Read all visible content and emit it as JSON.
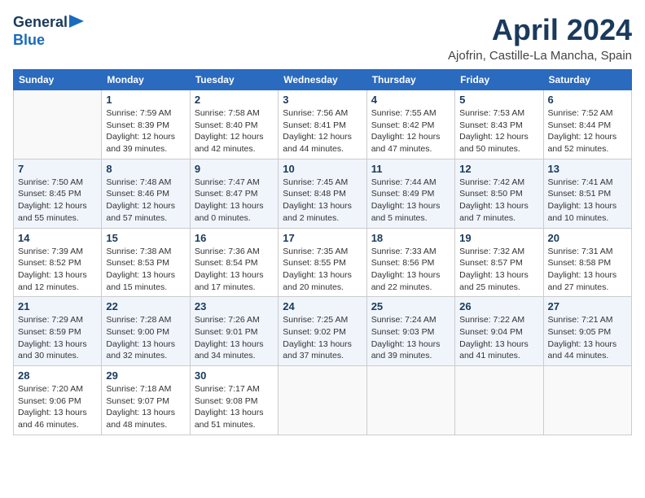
{
  "header": {
    "logo_line1": "General",
    "logo_line2": "Blue",
    "title": "April 2024",
    "subtitle": "Ajofrin, Castille-La Mancha, Spain"
  },
  "weekdays": [
    "Sunday",
    "Monday",
    "Tuesday",
    "Wednesday",
    "Thursday",
    "Friday",
    "Saturday"
  ],
  "weeks": [
    [
      {
        "day": "",
        "info": ""
      },
      {
        "day": "1",
        "info": "Sunrise: 7:59 AM\nSunset: 8:39 PM\nDaylight: 12 hours\nand 39 minutes."
      },
      {
        "day": "2",
        "info": "Sunrise: 7:58 AM\nSunset: 8:40 PM\nDaylight: 12 hours\nand 42 minutes."
      },
      {
        "day": "3",
        "info": "Sunrise: 7:56 AM\nSunset: 8:41 PM\nDaylight: 12 hours\nand 44 minutes."
      },
      {
        "day": "4",
        "info": "Sunrise: 7:55 AM\nSunset: 8:42 PM\nDaylight: 12 hours\nand 47 minutes."
      },
      {
        "day": "5",
        "info": "Sunrise: 7:53 AM\nSunset: 8:43 PM\nDaylight: 12 hours\nand 50 minutes."
      },
      {
        "day": "6",
        "info": "Sunrise: 7:52 AM\nSunset: 8:44 PM\nDaylight: 12 hours\nand 52 minutes."
      }
    ],
    [
      {
        "day": "7",
        "info": "Sunrise: 7:50 AM\nSunset: 8:45 PM\nDaylight: 12 hours\nand 55 minutes."
      },
      {
        "day": "8",
        "info": "Sunrise: 7:48 AM\nSunset: 8:46 PM\nDaylight: 12 hours\nand 57 minutes."
      },
      {
        "day": "9",
        "info": "Sunrise: 7:47 AM\nSunset: 8:47 PM\nDaylight: 13 hours\nand 0 minutes."
      },
      {
        "day": "10",
        "info": "Sunrise: 7:45 AM\nSunset: 8:48 PM\nDaylight: 13 hours\nand 2 minutes."
      },
      {
        "day": "11",
        "info": "Sunrise: 7:44 AM\nSunset: 8:49 PM\nDaylight: 13 hours\nand 5 minutes."
      },
      {
        "day": "12",
        "info": "Sunrise: 7:42 AM\nSunset: 8:50 PM\nDaylight: 13 hours\nand 7 minutes."
      },
      {
        "day": "13",
        "info": "Sunrise: 7:41 AM\nSunset: 8:51 PM\nDaylight: 13 hours\nand 10 minutes."
      }
    ],
    [
      {
        "day": "14",
        "info": "Sunrise: 7:39 AM\nSunset: 8:52 PM\nDaylight: 13 hours\nand 12 minutes."
      },
      {
        "day": "15",
        "info": "Sunrise: 7:38 AM\nSunset: 8:53 PM\nDaylight: 13 hours\nand 15 minutes."
      },
      {
        "day": "16",
        "info": "Sunrise: 7:36 AM\nSunset: 8:54 PM\nDaylight: 13 hours\nand 17 minutes."
      },
      {
        "day": "17",
        "info": "Sunrise: 7:35 AM\nSunset: 8:55 PM\nDaylight: 13 hours\nand 20 minutes."
      },
      {
        "day": "18",
        "info": "Sunrise: 7:33 AM\nSunset: 8:56 PM\nDaylight: 13 hours\nand 22 minutes."
      },
      {
        "day": "19",
        "info": "Sunrise: 7:32 AM\nSunset: 8:57 PM\nDaylight: 13 hours\nand 25 minutes."
      },
      {
        "day": "20",
        "info": "Sunrise: 7:31 AM\nSunset: 8:58 PM\nDaylight: 13 hours\nand 27 minutes."
      }
    ],
    [
      {
        "day": "21",
        "info": "Sunrise: 7:29 AM\nSunset: 8:59 PM\nDaylight: 13 hours\nand 30 minutes."
      },
      {
        "day": "22",
        "info": "Sunrise: 7:28 AM\nSunset: 9:00 PM\nDaylight: 13 hours\nand 32 minutes."
      },
      {
        "day": "23",
        "info": "Sunrise: 7:26 AM\nSunset: 9:01 PM\nDaylight: 13 hours\nand 34 minutes."
      },
      {
        "day": "24",
        "info": "Sunrise: 7:25 AM\nSunset: 9:02 PM\nDaylight: 13 hours\nand 37 minutes."
      },
      {
        "day": "25",
        "info": "Sunrise: 7:24 AM\nSunset: 9:03 PM\nDaylight: 13 hours\nand 39 minutes."
      },
      {
        "day": "26",
        "info": "Sunrise: 7:22 AM\nSunset: 9:04 PM\nDaylight: 13 hours\nand 41 minutes."
      },
      {
        "day": "27",
        "info": "Sunrise: 7:21 AM\nSunset: 9:05 PM\nDaylight: 13 hours\nand 44 minutes."
      }
    ],
    [
      {
        "day": "28",
        "info": "Sunrise: 7:20 AM\nSunset: 9:06 PM\nDaylight: 13 hours\nand 46 minutes."
      },
      {
        "day": "29",
        "info": "Sunrise: 7:18 AM\nSunset: 9:07 PM\nDaylight: 13 hours\nand 48 minutes."
      },
      {
        "day": "30",
        "info": "Sunrise: 7:17 AM\nSunset: 9:08 PM\nDaylight: 13 hours\nand 51 minutes."
      },
      {
        "day": "",
        "info": ""
      },
      {
        "day": "",
        "info": ""
      },
      {
        "day": "",
        "info": ""
      },
      {
        "day": "",
        "info": ""
      }
    ]
  ]
}
